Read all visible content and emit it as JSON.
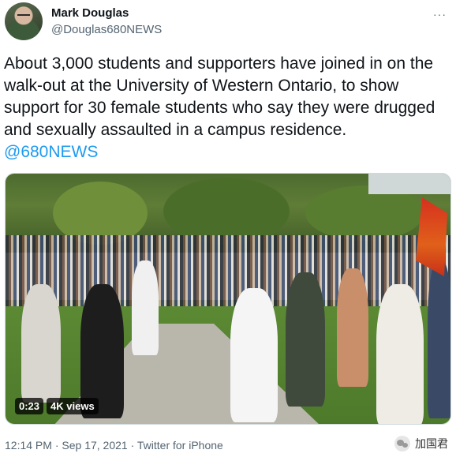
{
  "author": {
    "name": "Mark Douglas",
    "handle": "@Douglas680NEWS"
  },
  "menu": {
    "icon": "more-horizontal-icon",
    "label": "···"
  },
  "tweet": {
    "text": "About 3,000 students and supporters have joined in on the walk-out at the University of Western Ontario, to show support for 30 female students who say they were drugged and sexually assaulted in a campus residence.",
    "mention": "@680NEWS"
  },
  "media": {
    "duration": "0:23",
    "views": "4K views"
  },
  "footer": {
    "time": "12:14 PM",
    "date": "Sep 17, 2021",
    "separator": "·",
    "source": "Twitter for iPhone"
  },
  "watermark": {
    "icon": "wechat-icon",
    "label": "加国君"
  },
  "colors": {
    "link": "#1d9bf0",
    "secondary_text": "#536471"
  }
}
